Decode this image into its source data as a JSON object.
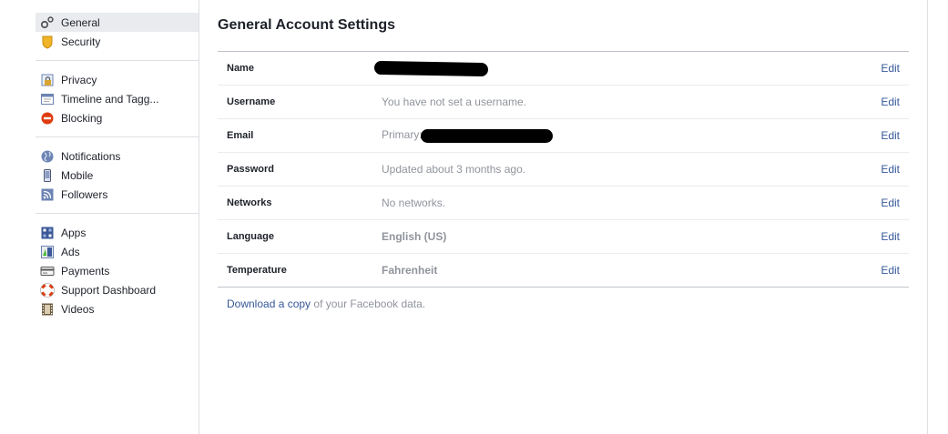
{
  "sidebar": {
    "groups": [
      [
        {
          "label": "General",
          "icon": "gears-icon",
          "selected": true
        },
        {
          "label": "Security",
          "icon": "badge-icon"
        }
      ],
      [
        {
          "label": "Privacy",
          "icon": "privacy-lock-icon"
        },
        {
          "label": "Timeline and Tagg...",
          "icon": "timeline-icon"
        },
        {
          "label": "Blocking",
          "icon": "blocking-icon"
        }
      ],
      [
        {
          "label": "Notifications",
          "icon": "globe-icon"
        },
        {
          "label": "Mobile",
          "icon": "mobile-icon"
        },
        {
          "label": "Followers",
          "icon": "rss-icon"
        }
      ],
      [
        {
          "label": "Apps",
          "icon": "apps-icon"
        },
        {
          "label": "Ads",
          "icon": "ads-icon"
        },
        {
          "label": "Payments",
          "icon": "credit-card-icon"
        },
        {
          "label": "Support Dashboard",
          "icon": "lifebuoy-icon"
        },
        {
          "label": "Videos",
          "icon": "film-icon"
        }
      ]
    ]
  },
  "main": {
    "title": "General Account Settings",
    "rows": [
      {
        "label": "Name",
        "value": "",
        "redacted": true,
        "edit": "Edit"
      },
      {
        "label": "Username",
        "value": "You have not set a username.",
        "edit": "Edit"
      },
      {
        "label": "Email",
        "value": "Primary:",
        "redacted": true,
        "edit": "Edit"
      },
      {
        "label": "Password",
        "value": "Updated about 3 months ago.",
        "edit": "Edit"
      },
      {
        "label": "Networks",
        "value": "No networks.",
        "edit": "Edit"
      },
      {
        "label": "Language",
        "value": "English (US)",
        "bold": true,
        "edit": "Edit"
      },
      {
        "label": "Temperature",
        "value": "Fahrenheit",
        "bold": true,
        "edit": "Edit"
      }
    ],
    "footer": {
      "link": "Download a copy",
      "text": " of your Facebook data."
    }
  },
  "colors": {
    "link": "#365899",
    "muted": "#90949c",
    "selected_bg": "#e9ebee"
  }
}
